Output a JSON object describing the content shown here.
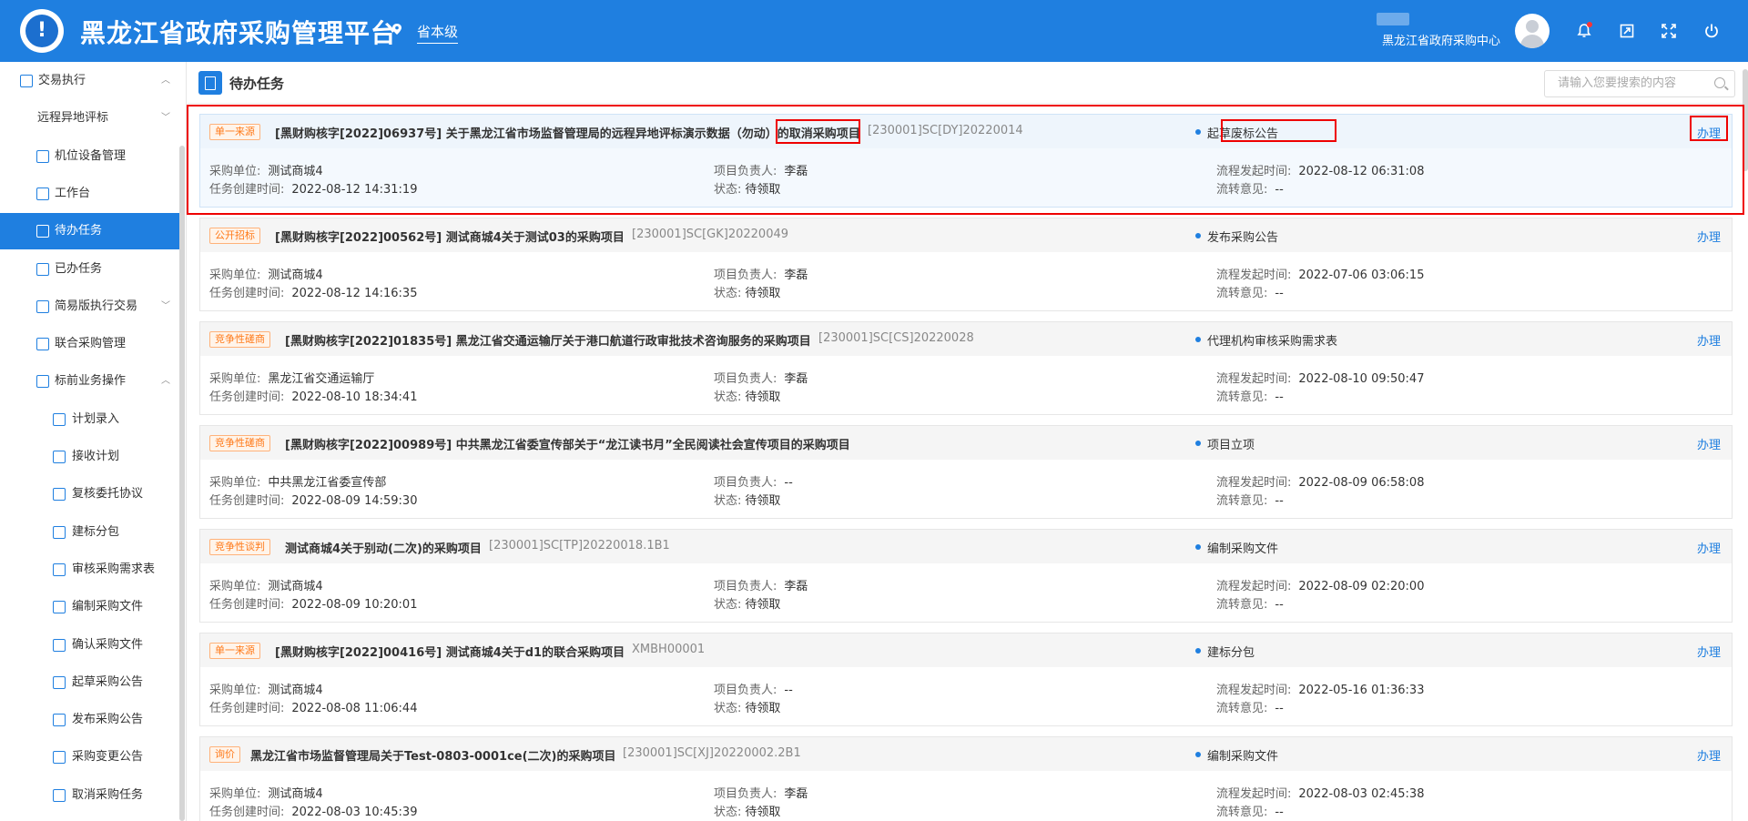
{
  "header": {
    "app_title": "黑龙江省政府采购管理平台",
    "location": "省本级",
    "user_org": "黑龙江省政府采购中心"
  },
  "sidebar": {
    "items": [
      {
        "label": "交易执行",
        "icon": "transaction-icon",
        "chevron": "︿",
        "level": 1
      },
      {
        "label": "远程异地评标",
        "icon": "",
        "chevron": "﹀",
        "level": 2
      },
      {
        "label": "机位设备管理",
        "icon": "device-icon",
        "chevron": "",
        "level": 2
      },
      {
        "label": "工作台",
        "icon": "workbench-icon",
        "chevron": "",
        "level": 2
      },
      {
        "label": "待办任务",
        "icon": "todo-icon",
        "chevron": "",
        "level": 2,
        "active": true
      },
      {
        "label": "已办任务",
        "icon": "done-icon",
        "chevron": "",
        "level": 2
      },
      {
        "label": "简易版执行交易",
        "icon": "simple-icon",
        "chevron": "﹀",
        "level": 2
      },
      {
        "label": "联合采购管理",
        "icon": "joint-icon",
        "chevron": "",
        "level": 2
      },
      {
        "label": "标前业务操作",
        "icon": "cart-icon",
        "chevron": "︿",
        "level": 2
      },
      {
        "label": "计划录入",
        "icon": "plan-icon",
        "chevron": "",
        "level": 3
      },
      {
        "label": "接收计划",
        "icon": "receive-icon",
        "chevron": "",
        "level": 3
      },
      {
        "label": "复核委托协议",
        "icon": "review-icon",
        "chevron": "",
        "level": 3
      },
      {
        "label": "建标分包",
        "icon": "package-icon",
        "chevron": "",
        "level": 3
      },
      {
        "label": "审核采购需求表",
        "icon": "audit-icon",
        "chevron": "",
        "level": 3
      },
      {
        "label": "编制采购文件",
        "icon": "edit-icon",
        "chevron": "",
        "level": 3
      },
      {
        "label": "确认采购文件",
        "icon": "confirm-icon",
        "chevron": "",
        "level": 3
      },
      {
        "label": "起草采购公告",
        "icon": "draft-icon",
        "chevron": "",
        "level": 3
      },
      {
        "label": "发布采购公告",
        "icon": "publish-icon",
        "chevron": "",
        "level": 3
      },
      {
        "label": "采购变更公告",
        "icon": "change-icon",
        "chevron": "",
        "level": 3
      },
      {
        "label": "取消采购任务",
        "icon": "cancel-icon",
        "chevron": "",
        "level": 3
      }
    ]
  },
  "page": {
    "title": "待办任务",
    "search_placeholder": "请输入您要搜索的内容"
  },
  "labels": {
    "purchaser": "采购单位:",
    "created": "任务创建时间:",
    "manager": "项目负责人:",
    "status": "状态:",
    "flow_start": "流程发起时间:",
    "flow_note": "流转意见:"
  },
  "tasks": [
    {
      "badge": "单一来源",
      "title": "[黑财购核字[2022]06937号] 关于黑龙江省市场监督管理局的远程异地评标演示数据（勿动）的取消采购项目",
      "code": "[230001]SC[DY]20220014",
      "stage": "起草废标公告",
      "action": "办理",
      "purchaser": "测试商城4",
      "created": "2022-08-12 14:31:19",
      "manager": "李磊",
      "status": "待领取",
      "flow_start": "2022-08-12 06:31:08",
      "flow_note": "--"
    },
    {
      "badge": "公开招标",
      "title": "[黑财购核字[2022]00562号] 测试商城4关于测试03的采购项目",
      "code": "[230001]SC[GK]20220049",
      "stage": "发布采购公告",
      "action": "办理",
      "purchaser": "测试商城4",
      "created": "2022-08-12 14:16:35",
      "manager": "李磊",
      "status": "待领取",
      "flow_start": "2022-07-06 03:06:15",
      "flow_note": "--"
    },
    {
      "badge": "竞争性磋商",
      "title": "[黑财购核字[2022]01835号] 黑龙江省交通运输厅关于港口航道行政审批技术咨询服务的采购项目",
      "code": "[230001]SC[CS]20220028",
      "stage": "代理机构审核采购需求表",
      "action": "办理",
      "purchaser": "黑龙江省交通运输厅",
      "created": "2022-08-10 18:34:41",
      "manager": "李磊",
      "status": "待领取",
      "flow_start": "2022-08-10 09:50:47",
      "flow_note": "--"
    },
    {
      "badge": "竞争性磋商",
      "title": "[黑财购核字[2022]00989号] 中共黑龙江省委宣传部关于“龙江读书月”全民阅读社会宣传项目的采购项目",
      "code": "",
      "stage": "项目立项",
      "action": "办理",
      "purchaser": "中共黑龙江省委宣传部",
      "created": "2022-08-09 14:59:30",
      "manager": "--",
      "status": "待领取",
      "flow_start": "2022-08-09 06:58:08",
      "flow_note": "--"
    },
    {
      "badge": "竞争性谈判",
      "title": "测试商城4关于别动(二次)的采购项目",
      "code": "[230001]SC[TP]20220018.1B1",
      "stage": "编制采购文件",
      "action": "办理",
      "purchaser": "测试商城4",
      "created": "2022-08-09 10:20:01",
      "manager": "李磊",
      "status": "待领取",
      "flow_start": "2022-08-09 02:20:00",
      "flow_note": "--"
    },
    {
      "badge": "单一来源",
      "title": "[黑财购核字[2022]00416号] 测试商城4关于d1的联合采购项目",
      "code": "XMBH00001",
      "stage": "建标分包",
      "action": "办理",
      "purchaser": "测试商城4",
      "created": "2022-08-08 11:06:44",
      "manager": "--",
      "status": "待领取",
      "flow_start": "2022-05-16 01:36:33",
      "flow_note": "--"
    },
    {
      "badge": "询价",
      "title": "黑龙江省市场监督管理局关于Test-0803-0001ce(二次)的采购项目",
      "code": "[230001]SC[XJ]20220002.2B1",
      "stage": "编制采购文件",
      "action": "办理",
      "purchaser": "测试商城4",
      "created": "2022-08-03 10:45:39",
      "manager": "李磊",
      "status": "待领取",
      "flow_start": "2022-08-03 02:45:38",
      "flow_note": "--"
    }
  ],
  "colors": {
    "primary": "#1f7fe0",
    "badge": "#ff7a1a",
    "annotation": "#e00000"
  }
}
